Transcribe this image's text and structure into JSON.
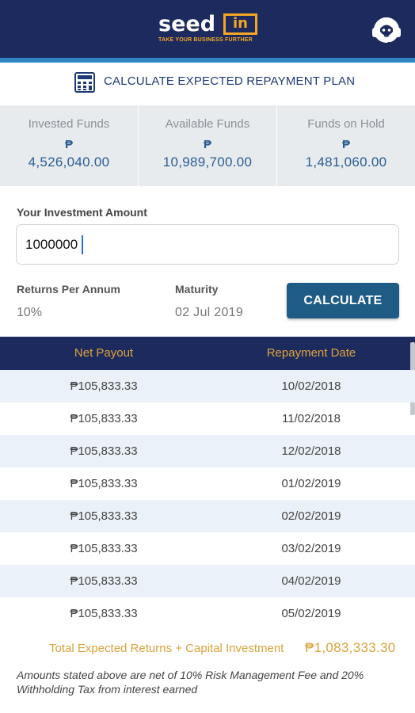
{
  "header": {
    "logo_word": "seed",
    "logo_in": "in",
    "logo_tagline": "TAKE YOUR BUSINESS FURTHER",
    "bg_color": "#1c2a5e",
    "accent_color": "#f5a623",
    "support_icon": "support-agent-icon"
  },
  "calculator": {
    "title": "CALCULATE EXPECTED REPAYMENT PLAN",
    "icon": "calculator-icon"
  },
  "funds": [
    {
      "label": "Invested Funds",
      "currency": "₱",
      "value": "4,526,040.00"
    },
    {
      "label": "Available Funds",
      "currency": "₱",
      "value": "10,989,700.00"
    },
    {
      "label": "Funds on Hold",
      "currency": "₱",
      "value": "1,481,060.00"
    }
  ],
  "investment": {
    "label": "Your Investment Amount",
    "value": "1000000",
    "returns_label": "Returns Per Annum",
    "returns_value": "10%",
    "maturity_label": "Maturity",
    "maturity_value": "02 Jul 2019",
    "button_label": "CALCULATE"
  },
  "table": {
    "headers": [
      "Net Payout",
      "Repayment Date"
    ],
    "rows": [
      {
        "payout": "₱105,833.33",
        "date": "10/02/2018"
      },
      {
        "payout": "₱105,833.33",
        "date": "11/02/2018"
      },
      {
        "payout": "₱105,833.33",
        "date": "12/02/2018"
      },
      {
        "payout": "₱105,833.33",
        "date": "01/02/2019"
      },
      {
        "payout": "₱105,833.33",
        "date": "02/02/2019"
      },
      {
        "payout": "₱105,833.33",
        "date": "03/02/2019"
      },
      {
        "payout": "₱105,833.33",
        "date": "04/02/2019"
      },
      {
        "payout": "₱105,833.33",
        "date": "05/02/2019"
      }
    ]
  },
  "summary": {
    "total_label": "Total Expected Returns + Capital Investment",
    "total_value": "₱1,083,333.30",
    "note": "Amounts stated above are net of 10% Risk Management Fee and 20% Withholding Tax from interest earned"
  }
}
